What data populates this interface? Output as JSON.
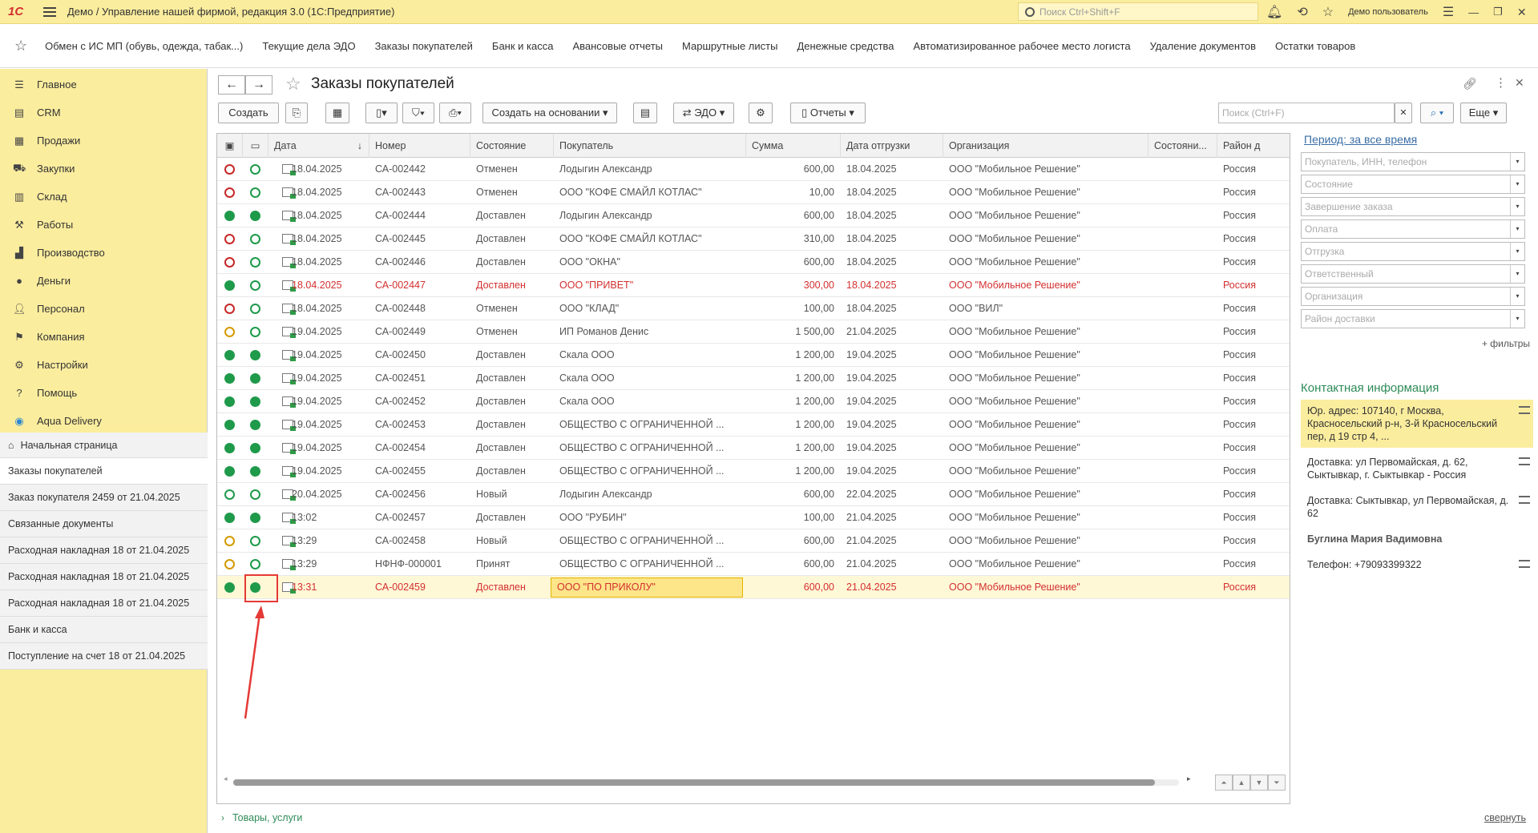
{
  "titlebar": {
    "logo": "1С",
    "title": "Демо / Управление нашей фирмой, редакция 3.0  (1С:Предприятие)",
    "search_placeholder": "Поиск Ctrl+Shift+F",
    "user": "Демо пользователь"
  },
  "quicklinks": [
    "Обмен с ИС МП (обувь, одежда, табак...)",
    "Текущие дела ЭДО",
    "Заказы покупателей",
    "Банк и касса",
    "Авансовые отчеты",
    "Маршрутные листы",
    "Денежные средства",
    "Автоматизированное рабочее место логиста",
    "Удаление документов",
    "Остатки товаров"
  ],
  "sidebar": {
    "sections": [
      {
        "label": "Главное",
        "icon": "menu-icon"
      },
      {
        "label": "CRM",
        "icon": "crm-icon"
      },
      {
        "label": "Продажи",
        "icon": "sales-icon"
      },
      {
        "label": "Закупки",
        "icon": "purchases-icon"
      },
      {
        "label": "Склад",
        "icon": "warehouse-icon"
      },
      {
        "label": "Работы",
        "icon": "tools-icon"
      },
      {
        "label": "Производство",
        "icon": "production-icon"
      },
      {
        "label": "Деньги",
        "icon": "money-icon"
      },
      {
        "label": "Персонал",
        "icon": "people-icon"
      },
      {
        "label": "Компания",
        "icon": "flag-icon"
      },
      {
        "label": "Настройки",
        "icon": "gear-icon"
      },
      {
        "label": "Помощь",
        "icon": "help-icon"
      },
      {
        "label": "Aqua Delivery",
        "icon": "location-icon"
      }
    ],
    "home": "Начальная страница",
    "history": [
      "Заказы покупателей",
      "Заказ покупателя 2459 от 21.04.2025",
      "Связанные документы",
      "Расходная накладная 18 от 21.04.2025",
      "Расходная накладная 18 от 21.04.2025",
      "Расходная накладная 18 от 21.04.2025",
      "Банк и касса",
      "Поступление на счет 18 от 21.04.2025"
    ]
  },
  "form": {
    "title": "Заказы покупателей",
    "buttons": {
      "create": "Создать",
      "create_based": "Создать на основании",
      "edo": "ЭДО",
      "reports": "Отчеты",
      "more": "Еще"
    },
    "search_placeholder": "Поиск (Ctrl+F)",
    "bottom_link": "Товары, услуги",
    "collapse": "свернуть"
  },
  "table": {
    "columns": [
      "Дата",
      "Номер",
      "Состояние",
      "Покупатель",
      "Сумма",
      "Дата отгрузки",
      "Организация",
      "Состояни...",
      "Район д"
    ],
    "rows": [
      {
        "s1": "or",
        "s2": "og",
        "date": "18.04.2025",
        "num": "СА-002442",
        "state": "Отменен",
        "buyer": "Лодыгин Александр",
        "sum": "600,00",
        "ship": "18.04.2025",
        "org": "ООО \"Мобильное Решение\"",
        "region": "Россия",
        "red": false
      },
      {
        "s1": "or",
        "s2": "og",
        "date": "18.04.2025",
        "num": "СА-002443",
        "state": "Отменен",
        "buyer": "ООО \"КОФЕ СМАЙЛ КОТЛАС\"",
        "sum": "10,00",
        "ship": "18.04.2025",
        "org": "ООО \"Мобильное Решение\"",
        "region": "Россия",
        "red": false
      },
      {
        "s1": "fg",
        "s2": "fg",
        "date": "18.04.2025",
        "num": "СА-002444",
        "state": "Доставлен",
        "buyer": "Лодыгин Александр",
        "sum": "600,00",
        "ship": "18.04.2025",
        "org": "ООО \"Мобильное Решение\"",
        "region": "Россия",
        "red": false
      },
      {
        "s1": "or",
        "s2": "og",
        "date": "18.04.2025",
        "num": "СА-002445",
        "state": "Доставлен",
        "buyer": "ООО \"КОФЕ СМАЙЛ КОТЛАС\"",
        "sum": "310,00",
        "ship": "18.04.2025",
        "org": "ООО \"Мобильное Решение\"",
        "region": "Россия",
        "red": false
      },
      {
        "s1": "or",
        "s2": "og",
        "date": "18.04.2025",
        "num": "СА-002446",
        "state": "Доставлен",
        "buyer": "ООО \"ОКНА\"",
        "sum": "600,00",
        "ship": "18.04.2025",
        "org": "ООО \"Мобильное Решение\"",
        "region": "Россия",
        "red": false
      },
      {
        "s1": "fg",
        "s2": "og",
        "date": "18.04.2025",
        "num": "СА-002447",
        "state": "Доставлен",
        "buyer": "ООО \"ПРИВЕТ\"",
        "sum": "300,00",
        "ship": "18.04.2025",
        "org": "ООО \"Мобильное Решение\"",
        "region": "Россия",
        "red": true
      },
      {
        "s1": "or",
        "s2": "og",
        "date": "18.04.2025",
        "num": "СА-002448",
        "state": "Отменен",
        "buyer": "ООО \"КЛАД\"",
        "sum": "100,00",
        "ship": "18.04.2025",
        "org": "ООО \"ВИЛ\"",
        "region": "Россия",
        "red": false
      },
      {
        "s1": "oy",
        "s2": "og",
        "date": "19.04.2025",
        "num": "СА-002449",
        "state": "Отменен",
        "buyer": "ИП Романов Денис",
        "sum": "1 500,00",
        "ship": "21.04.2025",
        "org": "ООО \"Мобильное Решение\"",
        "region": "Россия",
        "red": false
      },
      {
        "s1": "fg",
        "s2": "fg",
        "date": "19.04.2025",
        "num": "СА-002450",
        "state": "Доставлен",
        "buyer": "Скала ООО",
        "sum": "1 200,00",
        "ship": "19.04.2025",
        "org": "ООО \"Мобильное Решение\"",
        "region": "Россия",
        "red": false
      },
      {
        "s1": "fg",
        "s2": "fg",
        "date": "19.04.2025",
        "num": "СА-002451",
        "state": "Доставлен",
        "buyer": "Скала ООО",
        "sum": "1 200,00",
        "ship": "19.04.2025",
        "org": "ООО \"Мобильное Решение\"",
        "region": "Россия",
        "red": false
      },
      {
        "s1": "fg",
        "s2": "fg",
        "date": "19.04.2025",
        "num": "СА-002452",
        "state": "Доставлен",
        "buyer": "Скала ООО",
        "sum": "1 200,00",
        "ship": "19.04.2025",
        "org": "ООО \"Мобильное Решение\"",
        "region": "Россия",
        "red": false
      },
      {
        "s1": "fg",
        "s2": "fg",
        "date": "19.04.2025",
        "num": "СА-002453",
        "state": "Доставлен",
        "buyer": "ОБЩЕСТВО С ОГРАНИЧЕННОЙ ...",
        "sum": "1 200,00",
        "ship": "19.04.2025",
        "org": "ООО \"Мобильное Решение\"",
        "region": "Россия",
        "red": false
      },
      {
        "s1": "fg",
        "s2": "fg",
        "date": "19.04.2025",
        "num": "СА-002454",
        "state": "Доставлен",
        "buyer": "ОБЩЕСТВО С ОГРАНИЧЕННОЙ ...",
        "sum": "1 200,00",
        "ship": "19.04.2025",
        "org": "ООО \"Мобильное Решение\"",
        "region": "Россия",
        "red": false
      },
      {
        "s1": "fg",
        "s2": "fg",
        "date": "19.04.2025",
        "num": "СА-002455",
        "state": "Доставлен",
        "buyer": "ОБЩЕСТВО С ОГРАНИЧЕННОЙ ...",
        "sum": "1 200,00",
        "ship": "19.04.2025",
        "org": "ООО \"Мобильное Решение\"",
        "region": "Россия",
        "red": false
      },
      {
        "s1": "og",
        "s2": "og",
        "date": "20.04.2025",
        "num": "СА-002456",
        "state": "Новый",
        "buyer": "Лодыгин Александр",
        "sum": "600,00",
        "ship": "22.04.2025",
        "org": "ООО \"Мобильное Решение\"",
        "region": "Россия",
        "red": false
      },
      {
        "s1": "fg",
        "s2": "fg",
        "date": "13:02",
        "num": "СА-002457",
        "state": "Доставлен",
        "buyer": "ООО \"РУБИН\"",
        "sum": "100,00",
        "ship": "21.04.2025",
        "org": "ООО \"Мобильное Решение\"",
        "region": "Россия",
        "red": false
      },
      {
        "s1": "oy",
        "s2": "og",
        "date": "13:29",
        "num": "СА-002458",
        "state": "Новый",
        "buyer": "ОБЩЕСТВО С ОГРАНИЧЕННОЙ ...",
        "sum": "600,00",
        "ship": "21.04.2025",
        "org": "ООО \"Мобильное Решение\"",
        "region": "Россия",
        "red": false
      },
      {
        "s1": "oy",
        "s2": "og",
        "date": "13:29",
        "num": "НФНФ-000001",
        "state": "Принят",
        "buyer": "ОБЩЕСТВО С ОГРАНИЧЕННОЙ ...",
        "sum": "600,00",
        "ship": "21.04.2025",
        "org": "ООО \"Мобильное Решение\"",
        "region": "Россия",
        "red": false
      },
      {
        "s1": "fg",
        "s2": "fg",
        "date": "13:31",
        "num": "СА-002459",
        "state": "Доставлен",
        "buyer": "ООО \"ПО ПРИКОЛУ\"",
        "sum": "600,00",
        "ship": "21.04.2025",
        "org": "ООО \"Мобильное Решение\"",
        "region": "Россия",
        "red": true,
        "selected": true
      }
    ]
  },
  "filters": {
    "period": "Период: за все время",
    "fields": [
      "Покупатель, ИНН, телефон",
      "Состояние",
      "Завершение заказа",
      "Оплата",
      "Отгрузка",
      "Ответственный",
      "Организация",
      "Район доставки"
    ],
    "more": "+ фильтры"
  },
  "contact": {
    "title": "Контактная информация",
    "items": [
      {
        "text": "Юр. адрес: 107140, г Москва, Красносельский р-н, 3-й Красносельский пер, д 19 стр 4, ...",
        "highlight": true,
        "menu": true
      },
      {
        "text": "Доставка: ул Первомайская, д. 62, Сыктывкар, г. Сыктывкар - Россия",
        "menu": true
      },
      {
        "text": "Доставка: Сыктывкар, ул Первомайская, д. 62",
        "menu": true
      },
      {
        "text": "Буглина Мария Вадимовна",
        "bold": true
      },
      {
        "text": "Телефон: +79093399322",
        "menu": true
      }
    ]
  },
  "colors": {
    "accent": "#fbed9e",
    "green": "#1e9a4a",
    "red": "#d32f2f",
    "annotation": "#e53935"
  }
}
